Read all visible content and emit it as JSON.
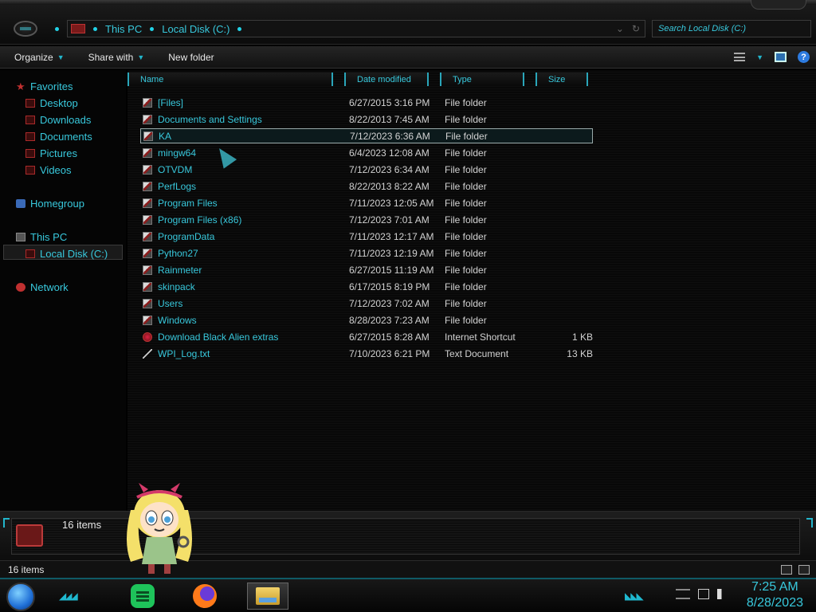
{
  "address_bar": {
    "crumbs": [
      "This PC",
      "Local Disk (C:)"
    ],
    "search_placeholder": "Search Local Disk (C:)"
  },
  "toolbar": {
    "organize": "Organize",
    "share_with": "Share with",
    "new_folder": "New folder"
  },
  "sidebar": {
    "favorites": "Favorites",
    "desktop": "Desktop",
    "downloads": "Downloads",
    "documents": "Documents",
    "pictures": "Pictures",
    "videos": "Videos",
    "homegroup": "Homegroup",
    "this_pc": "This PC",
    "local_disk": "Local Disk (C:)",
    "network": "Network"
  },
  "columns": {
    "name": "Name",
    "date_modified": "Date modified",
    "type": "Type",
    "size": "Size"
  },
  "files": [
    {
      "name": "[Files]",
      "date": "6/27/2015 3:16 PM",
      "type": "File folder",
      "size": ""
    },
    {
      "name": "Documents and Settings",
      "date": "8/22/2013 7:45 AM",
      "type": "File folder",
      "size": ""
    },
    {
      "name": "KA",
      "date": "7/12/2023 6:36 AM",
      "type": "File folder",
      "size": ""
    },
    {
      "name": "mingw64",
      "date": "6/4/2023 12:08 AM",
      "type": "File folder",
      "size": ""
    },
    {
      "name": "OTVDM",
      "date": "7/12/2023 6:34 AM",
      "type": "File folder",
      "size": ""
    },
    {
      "name": "PerfLogs",
      "date": "8/22/2013 8:22 AM",
      "type": "File folder",
      "size": ""
    },
    {
      "name": "Program Files",
      "date": "7/11/2023 12:05 AM",
      "type": "File folder",
      "size": ""
    },
    {
      "name": "Program Files (x86)",
      "date": "7/12/2023 7:01 AM",
      "type": "File folder",
      "size": ""
    },
    {
      "name": "ProgramData",
      "date": "7/11/2023 12:17 AM",
      "type": "File folder",
      "size": ""
    },
    {
      "name": "Python27",
      "date": "7/11/2023 12:19 AM",
      "type": "File folder",
      "size": ""
    },
    {
      "name": "Rainmeter",
      "date": "6/27/2015 11:19 AM",
      "type": "File folder",
      "size": ""
    },
    {
      "name": "skinpack",
      "date": "6/17/2015 8:19 PM",
      "type": "File folder",
      "size": ""
    },
    {
      "name": "Users",
      "date": "7/12/2023 7:02 AM",
      "type": "File folder",
      "size": ""
    },
    {
      "name": "Windows",
      "date": "8/28/2023 7:23 AM",
      "type": "File folder",
      "size": ""
    },
    {
      "name": "Download Black Alien extras",
      "date": "6/27/2015 8:28 AM",
      "type": "Internet Shortcut",
      "size": "1 KB"
    },
    {
      "name": "WPI_Log.txt",
      "date": "7/10/2023 6:21 PM",
      "type": "Text Document",
      "size": "13 KB"
    }
  ],
  "selected_file": "KA",
  "details_pane": {
    "count": "16 items"
  },
  "status_bar": {
    "count": "16 items"
  },
  "taskbar": {
    "time": "7:25 AM",
    "date": "8/28/2023"
  },
  "colors": {
    "accent": "#38c8dc",
    "background": "#000000",
    "brand_red": "#c03030"
  }
}
